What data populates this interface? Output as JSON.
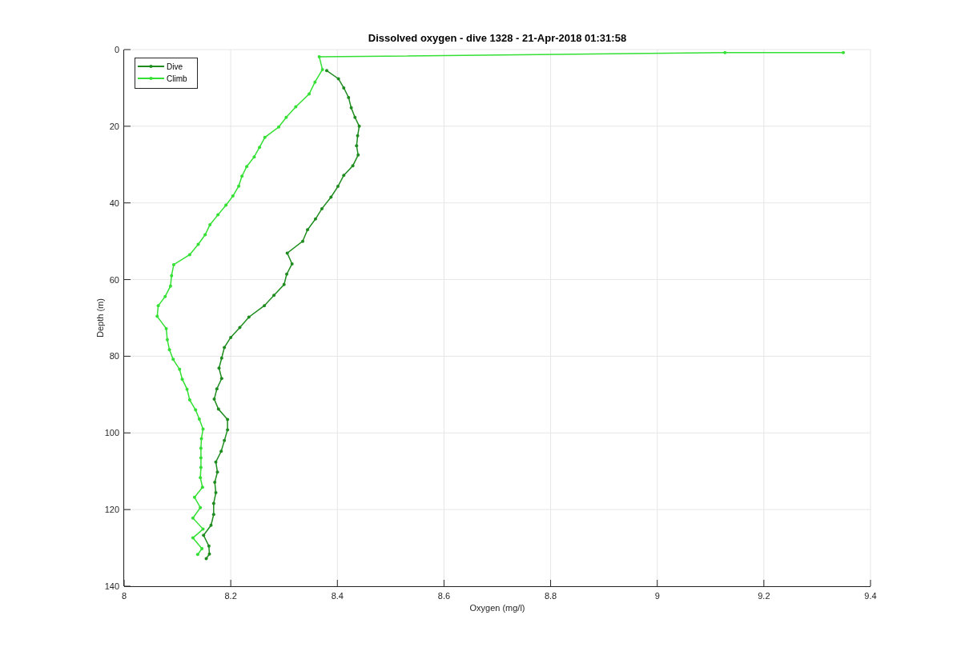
{
  "figure": {
    "chart_data": {
      "type": "line",
      "title": "Dissolved oxygen - dive 1328 - 21-Apr-2018 01:31:58",
      "xlabel": "Oxygen (mg/l)",
      "ylabel": "Depth (m)",
      "grid": true,
      "legend": true,
      "xlim": [
        8,
        9.4
      ],
      "ylim": [
        140,
        0
      ],
      "xticks": [
        {
          "value": 8,
          "label": "8"
        },
        {
          "value": 8.2,
          "label": "8.2"
        },
        {
          "value": 8.4,
          "label": "8.4"
        },
        {
          "value": 8.6,
          "label": "8.6"
        },
        {
          "value": 8.8,
          "label": "8.8"
        },
        {
          "value": 9,
          "label": "9"
        },
        {
          "value": 9.2,
          "label": "9.2"
        },
        {
          "value": 9.4,
          "label": "9.4"
        }
      ],
      "yticks": [
        {
          "value": 0,
          "label": "0"
        },
        {
          "value": 20,
          "label": "20"
        },
        {
          "value": 40,
          "label": "40"
        },
        {
          "value": 60,
          "label": "60"
        },
        {
          "value": 80,
          "label": "80"
        },
        {
          "value": 100,
          "label": "100"
        },
        {
          "value": 120,
          "label": "120"
        },
        {
          "value": 140,
          "label": "140"
        }
      ],
      "series": [
        {
          "name": "Dive",
          "color": "#1e8c1e",
          "x": [
            8.38,
            8.402,
            8.412,
            8.421,
            8.426,
            8.433,
            8.441,
            8.438,
            8.436,
            8.439,
            8.429,
            8.412,
            8.401,
            8.388,
            8.371,
            8.359,
            8.344,
            8.335,
            8.306,
            8.315,
            8.305,
            8.3,
            8.281,
            8.263,
            8.234,
            8.217,
            8.2,
            8.188,
            8.183,
            8.178,
            8.183,
            8.174,
            8.169,
            8.177,
            8.194,
            8.194,
            8.188,
            8.182,
            8.172,
            8.175,
            8.17,
            8.172,
            8.168,
            8.168,
            8.163,
            8.149,
            8.159,
            8.16,
            8.154
          ],
          "values": [
            5.5,
            7.6,
            10,
            12.5,
            15.2,
            17.7,
            20,
            22.5,
            25.1,
            27.5,
            30.3,
            32.8,
            35.7,
            38.5,
            41.5,
            44.2,
            47,
            50,
            53.1,
            55.9,
            58.6,
            61.3,
            64.1,
            66.8,
            69.8,
            72.5,
            75.1,
            77.7,
            80.5,
            83.1,
            85.8,
            88.5,
            91.2,
            93.8,
            96.5,
            99.2,
            102,
            104.8,
            107.6,
            110.2,
            112.9,
            115.6,
            118.4,
            121.3,
            124.1,
            126.7,
            129.5,
            131.6,
            132.8
          ]
        },
        {
          "name": "Climb",
          "color": "#33e033",
          "x": [
            8.138,
            8.146,
            8.129,
            8.148,
            8.129,
            8.143,
            8.132,
            8.147,
            8.143,
            8.144,
            8.144,
            8.144,
            8.145,
            8.148,
            8.141,
            8.134,
            8.123,
            8.118,
            8.109,
            8.104,
            8.092,
            8.085,
            8.081,
            8.079,
            8.062,
            8.064,
            8.077,
            8.087,
            8.089,
            8.093,
            8.123,
            8.139,
            8.152,
            8.161,
            8.176,
            8.191,
            8.204,
            8.215,
            8.221,
            8.23,
            8.244,
            8.254,
            8.264,
            8.29,
            8.304,
            8.322,
            8.347,
            8.358,
            8.372,
            8.366,
            9.127,
            9.349
          ],
          "values": [
            131.7,
            130.2,
            127.4,
            125.1,
            122.2,
            119.5,
            116.8,
            114.2,
            111.7,
            109,
            106.5,
            104,
            101.5,
            99,
            96.4,
            94,
            91.4,
            88.6,
            86,
            83.4,
            80.8,
            78.3,
            75.7,
            72.8,
            69.6,
            66.8,
            64.4,
            61.7,
            59,
            56.1,
            53.5,
            50.8,
            48.3,
            45.7,
            43.1,
            40.6,
            38.2,
            35.6,
            33,
            30.5,
            28,
            25.5,
            22.9,
            20.2,
            17.7,
            14.9,
            11.6,
            8.5,
            5.2,
            1.9,
            0.8,
            0.8
          ]
        }
      ]
    }
  }
}
